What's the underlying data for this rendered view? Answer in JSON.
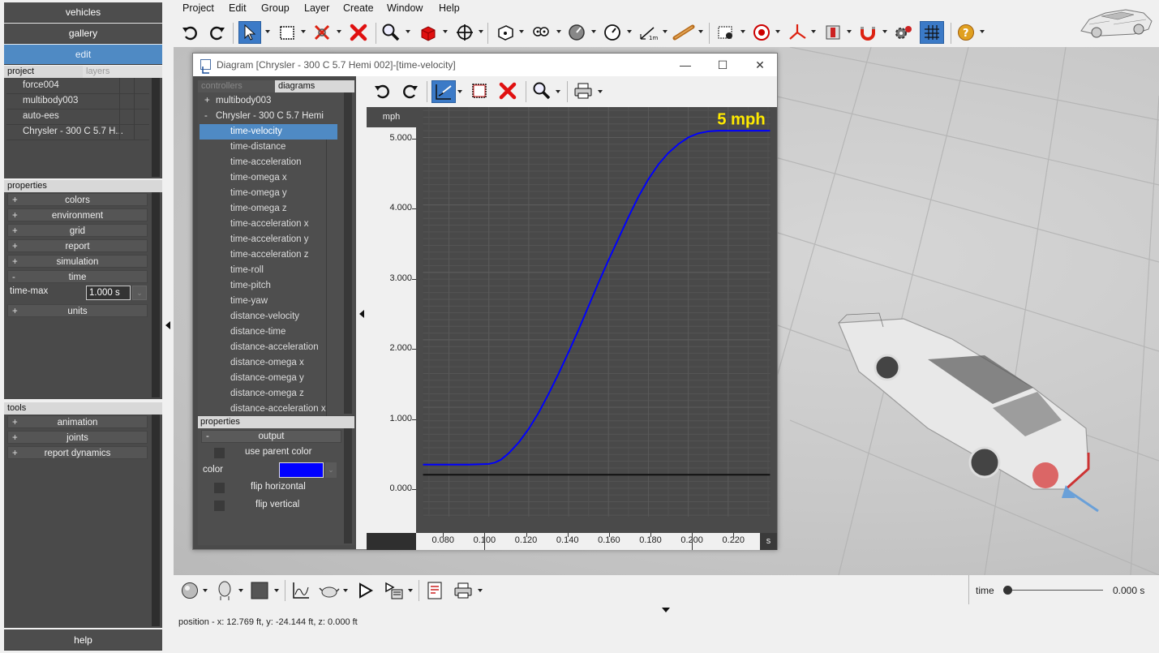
{
  "nav": {
    "vehicles": "vehicles",
    "gallery": "gallery",
    "edit": "edit",
    "help": "help"
  },
  "project_tabs": {
    "project": "project",
    "layers": "layers"
  },
  "project_items": [
    "force004",
    "multibody003",
    "auto-ees",
    "Chrysler - 300 C 5.7 H..."
  ],
  "properties": {
    "header": "properties",
    "rows": [
      {
        "pm": "+",
        "label": "colors"
      },
      {
        "pm": "+",
        "label": "environment"
      },
      {
        "pm": "+",
        "label": "grid"
      },
      {
        "pm": "+",
        "label": "report"
      },
      {
        "pm": "+",
        "label": "simulation"
      },
      {
        "pm": "-",
        "label": "time"
      }
    ],
    "time_max_label": "time-max",
    "time_max_value": "1.000 s",
    "units": {
      "pm": "+",
      "label": "units"
    }
  },
  "tools": {
    "header": "tools",
    "rows": [
      {
        "pm": "+",
        "label": "animation"
      },
      {
        "pm": "+",
        "label": "joints"
      },
      {
        "pm": "+",
        "label": "report dynamics"
      }
    ]
  },
  "menu": [
    "Project",
    "Edit",
    "Group",
    "Layer",
    "Create",
    "Window",
    "Help"
  ],
  "diagram_window": {
    "title": "Diagram [Chrysler - 300 C 5.7 Hemi 002]-[time-velocity]",
    "tabs": {
      "controllers": "controllers",
      "diagrams": "diagrams"
    },
    "tree": [
      {
        "pm": "+",
        "label": "multibody003"
      },
      {
        "pm": "-",
        "label": "Chrysler - 300 C 5.7 Hemi 002"
      }
    ],
    "diagrams": [
      "time-velocity",
      "time-distance",
      "time-acceleration",
      "time-omega x",
      "time-omega y",
      "time-omega z",
      "time-acceleration x",
      "time-acceleration y",
      "time-acceleration z",
      "time-roll",
      "time-pitch",
      "time-yaw",
      "distance-velocity",
      "distance-time",
      "distance-acceleration",
      "distance-omega x",
      "distance-omega y",
      "distance-omega z",
      "distance-acceleration x"
    ],
    "selected_index": 0,
    "props": {
      "header": "properties",
      "output_pm": "-",
      "output": "output",
      "use_parent_color": "use parent color",
      "color_label": "color",
      "flip_horizontal": "flip horizontal",
      "flip_vertical": "flip vertical",
      "color_value": "#0000ff"
    }
  },
  "chart_data": {
    "type": "line",
    "ylabel": "mph",
    "xunit": "s",
    "annotation": "5 mph",
    "annotation_color": "#ffea00",
    "line_color": "#0000ff",
    "xlim": [
      0.067,
      0.241
    ],
    "ylim": [
      -0.62,
      5.45
    ],
    "yticks": [
      0,
      1,
      2,
      3,
      4,
      5
    ],
    "ytick_labels": [
      "0.000",
      "1.000",
      "2.000",
      "3.000",
      "4.000",
      "5.000"
    ],
    "xticks": [
      0.08,
      0.1,
      0.12,
      0.14,
      0.16,
      0.18,
      0.2,
      0.22
    ],
    "xtick_labels": [
      "0.080",
      "0.100",
      "0.120",
      "0.140",
      "0.160",
      "0.180",
      "0.200",
      "0.220"
    ],
    "series": [
      {
        "x": [
          0.067,
          0.08,
          0.09,
          0.1,
          0.103,
          0.106,
          0.11,
          0.115,
          0.12,
          0.125,
          0.13,
          0.135,
          0.14,
          0.145,
          0.15,
          0.155,
          0.16,
          0.165,
          0.17,
          0.175,
          0.18,
          0.185,
          0.19,
          0.195,
          0.2,
          0.205,
          0.21,
          0.215,
          0.241
        ],
        "y": [
          0.15,
          0.15,
          0.15,
          0.16,
          0.18,
          0.22,
          0.32,
          0.48,
          0.68,
          0.92,
          1.2,
          1.5,
          1.82,
          2.15,
          2.5,
          2.85,
          3.18,
          3.5,
          3.82,
          4.12,
          4.38,
          4.6,
          4.77,
          4.9,
          5.0,
          5.06,
          5.09,
          5.1,
          5.1
        ]
      }
    ],
    "zero_line": true
  },
  "status": {
    "position": "position - x: 12.769 ft, y: -24.144 ft, z: 0.000 ft"
  },
  "time_slider": {
    "label": "time",
    "value": "0.000 s"
  }
}
